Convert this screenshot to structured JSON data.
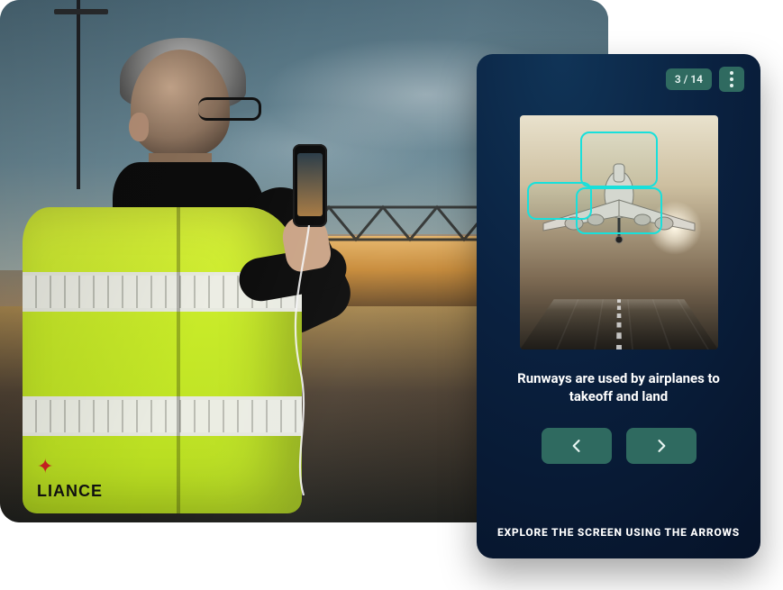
{
  "background_photo": {
    "description": "Airport worker in high-visibility vest photographing through a terminal window at sunset",
    "vest_text": "LIANCE",
    "vest_icon": "maple-leaf-icon"
  },
  "panel": {
    "page_indicator": "3 / 14",
    "menu_icon": "kebab-menu-icon",
    "lesson_image_alt": "Airplane landing on a runway, front view, with three highlight boxes",
    "highlight_boxes": 3,
    "caption": "Runways are used by airplanes to takeoff and land",
    "prev_label": "Previous",
    "next_label": "Next",
    "hint": "EXPLORE THE SCREEN USING THE ARROWS"
  },
  "colors": {
    "panel_bg": "#0a2140",
    "accent": "#2f6a60",
    "highlight": "#18e0db"
  }
}
